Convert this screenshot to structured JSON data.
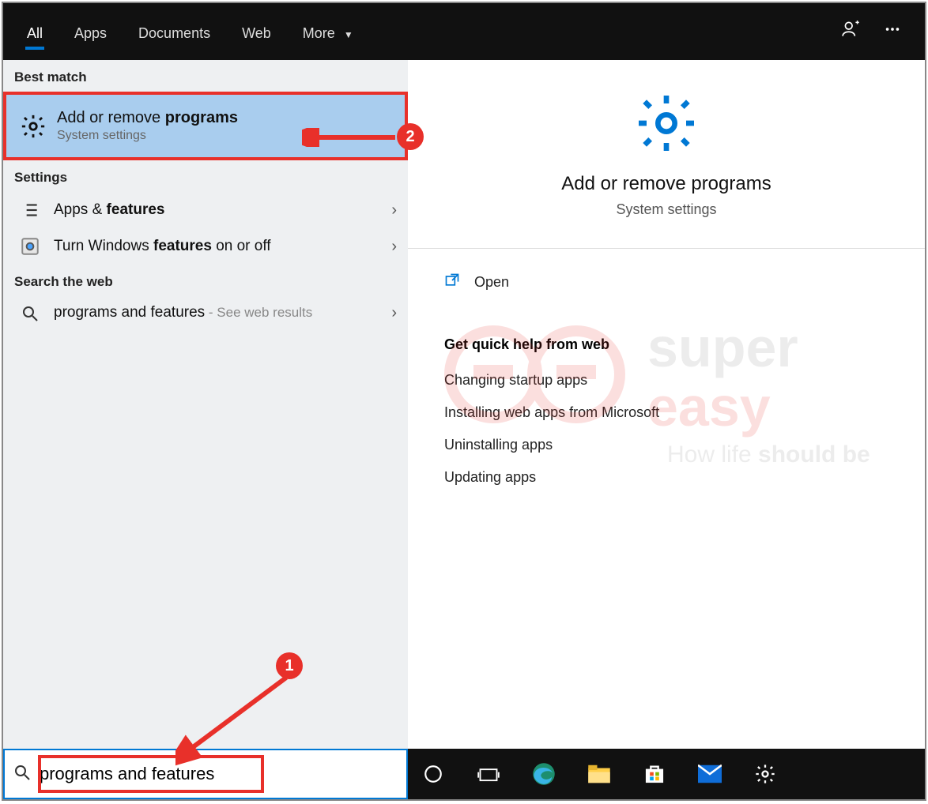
{
  "topbar": {
    "tabs": [
      "All",
      "Apps",
      "Documents",
      "Web",
      "More"
    ],
    "active_index": 0
  },
  "left": {
    "best_match_label": "Best match",
    "best_match": {
      "prefix": "Add or remove ",
      "bold": "programs",
      "sub": "System settings"
    },
    "settings_label": "Settings",
    "settings_items": [
      {
        "prefix": "Apps & ",
        "bold": "features"
      },
      {
        "prefix": "Turn Windows ",
        "bold": "features",
        "suffix": " on or off"
      }
    ],
    "web_label": "Search the web",
    "web_item": {
      "text": "programs and features",
      "hint": " - See web results"
    }
  },
  "preview": {
    "title": "Add or remove programs",
    "sub": "System settings",
    "open_label": "Open",
    "help_title": "Get quick help from web",
    "help_links": [
      "Changing startup apps",
      "Installing web apps from Microsoft",
      "Uninstalling apps",
      "Updating apps"
    ]
  },
  "search": {
    "value": "programs and features"
  },
  "annotations": {
    "step1": "1",
    "step2": "2"
  },
  "watermark": {
    "brand_top": "super",
    "brand_bottom": "easy",
    "tagline_prefix": "How life ",
    "tagline_bold": "should be"
  }
}
